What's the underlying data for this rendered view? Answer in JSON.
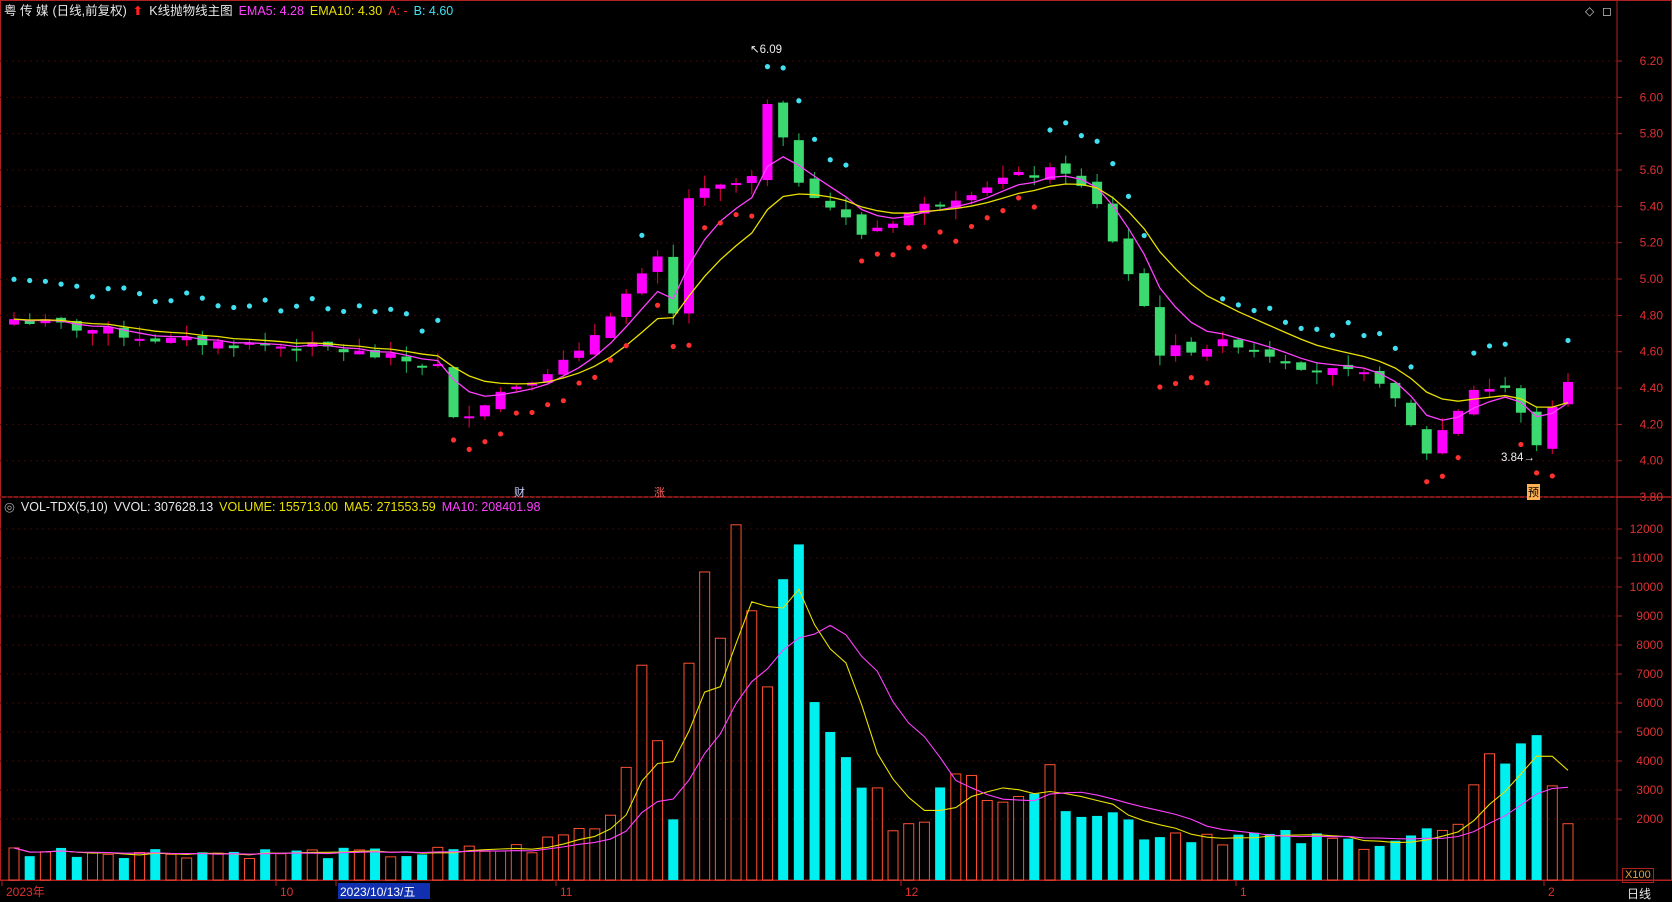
{
  "main_chart": {
    "header": {
      "stock": "粤 传 媒",
      "mode": "(日线,前复权)",
      "arrow_icon": "red-up-arrow-icon",
      "title": "K线抛物线主图",
      "ema5": "EMA5: 4.28",
      "ema10": "EMA10: 4.30",
      "a": "A: -",
      "b": "B: 4.60"
    },
    "price_axis": [
      "6.20",
      "6.00",
      "5.80",
      "5.60",
      "5.40",
      "5.20",
      "5.00",
      "4.80",
      "4.60",
      "4.40",
      "4.20",
      "4.00",
      "3.80"
    ],
    "high_label": "6.09",
    "low_label": "3.84",
    "event_tags": [
      "财",
      "涨",
      "预"
    ]
  },
  "volume_chart": {
    "header": {
      "name": "VOL-TDX(5,10)",
      "vvol": "VVOL: 307628.13",
      "volume": "VOLUME: 155713.00",
      "ma5": "MA5: 271553.59",
      "ma10": "MA10: 208401.98"
    },
    "axis": [
      "12000",
      "11000",
      "10000",
      "9000",
      "8000",
      "7000",
      "6000",
      "5000",
      "4000",
      "3000",
      "2000"
    ],
    "unit": "X100"
  },
  "date_axis": {
    "labels": [
      "2023年",
      "10",
      "2023/10/13/五",
      "11",
      "12",
      "1",
      "2"
    ],
    "period": "日线"
  },
  "window_icons": [
    "diamond-icon",
    "restore-icon"
  ],
  "colors": {
    "up": "#ff00ff",
    "down": "#3cd970",
    "ema5": "#ff40ff",
    "ema10": "#e8e000",
    "sar_dot": "#40e0f0",
    "sar_dot_low": "#ff3030",
    "vol_up": "#ff5030",
    "vol_down": "#00f0f0",
    "axis": "#b02020"
  }
}
